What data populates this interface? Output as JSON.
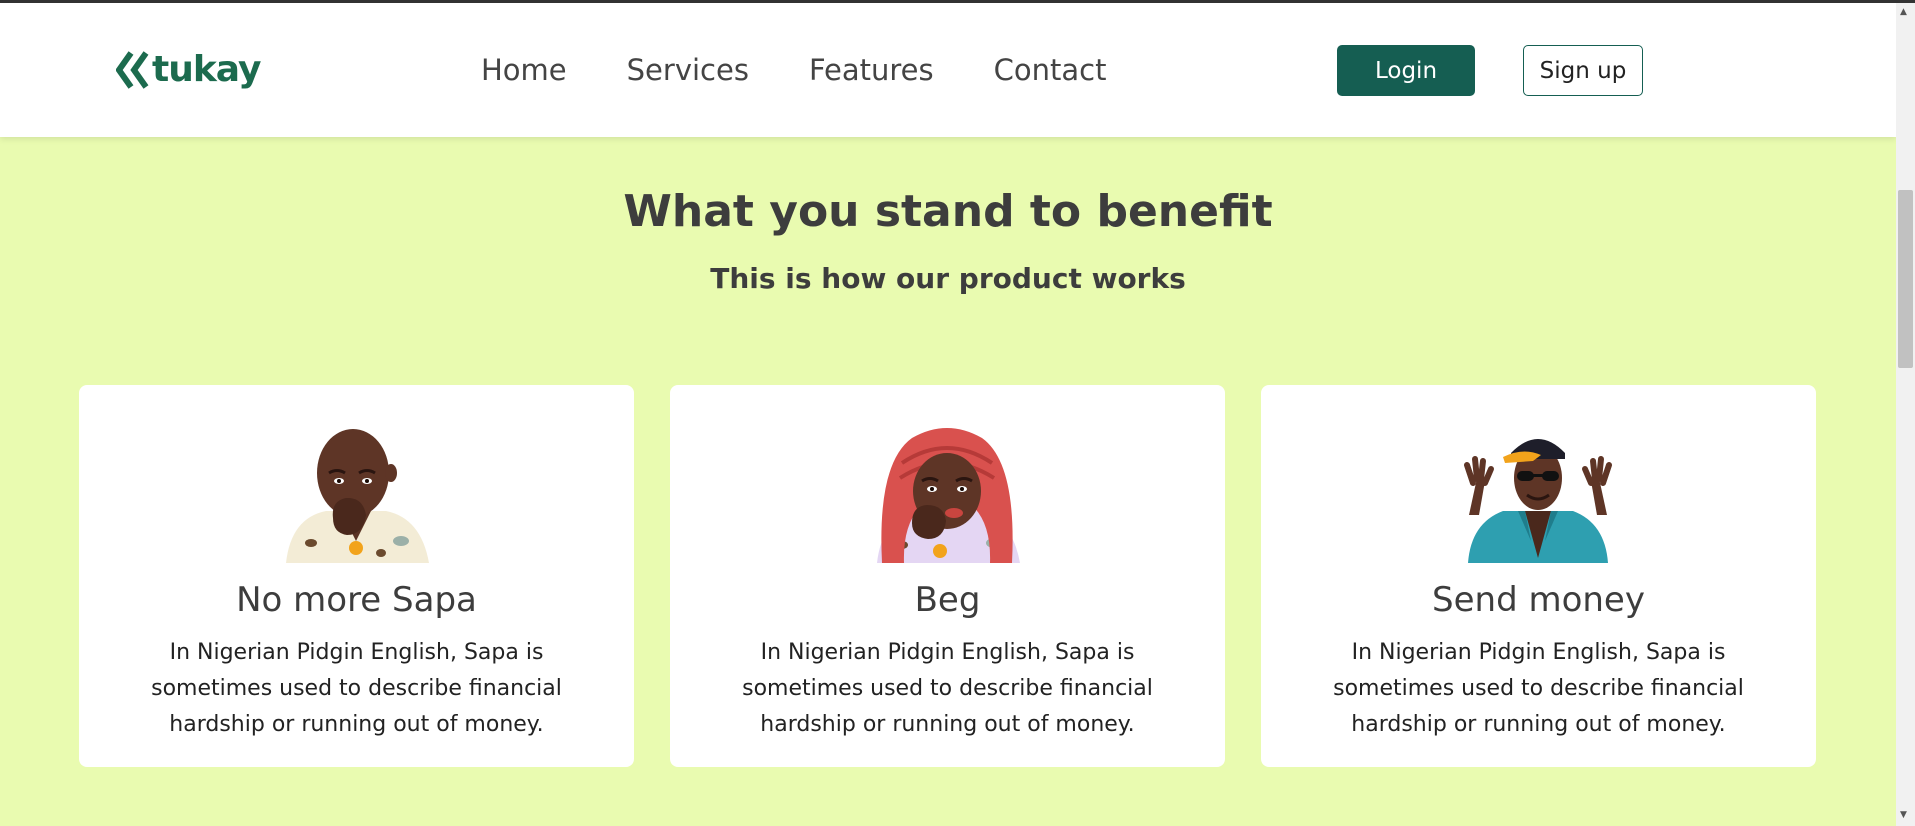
{
  "brand": {
    "name": "tukay",
    "logo_icon": "double-chevron-left-icon",
    "color": "#1c6b4e"
  },
  "nav": {
    "links": [
      "Home",
      "Services",
      "Features",
      "Contact"
    ],
    "login_label": "Login",
    "signup_label": "Sign up"
  },
  "colors": {
    "accent": "#155e52",
    "page_background": "#e9fbb0",
    "card_background": "#ffffff"
  },
  "section": {
    "title": "What you stand to benefit",
    "subtitle": "This is how our product works"
  },
  "cards": [
    {
      "title": "No more Sapa",
      "description": "In Nigerian Pidgin English, Sapa is sometimes used to describe financial hardship or running out of money.",
      "illustration": "thinking-man-illustration"
    },
    {
      "title": "Beg",
      "description": "In Nigerian Pidgin English, Sapa is sometimes used to describe financial hardship or running out of money.",
      "illustration": "thinking-woman-headwrap-illustration"
    },
    {
      "title": "Send money",
      "description": "In Nigerian Pidgin English, Sapa is sometimes used to describe financial hardship or running out of money.",
      "illustration": "waving-man-cap-illustration"
    }
  ]
}
